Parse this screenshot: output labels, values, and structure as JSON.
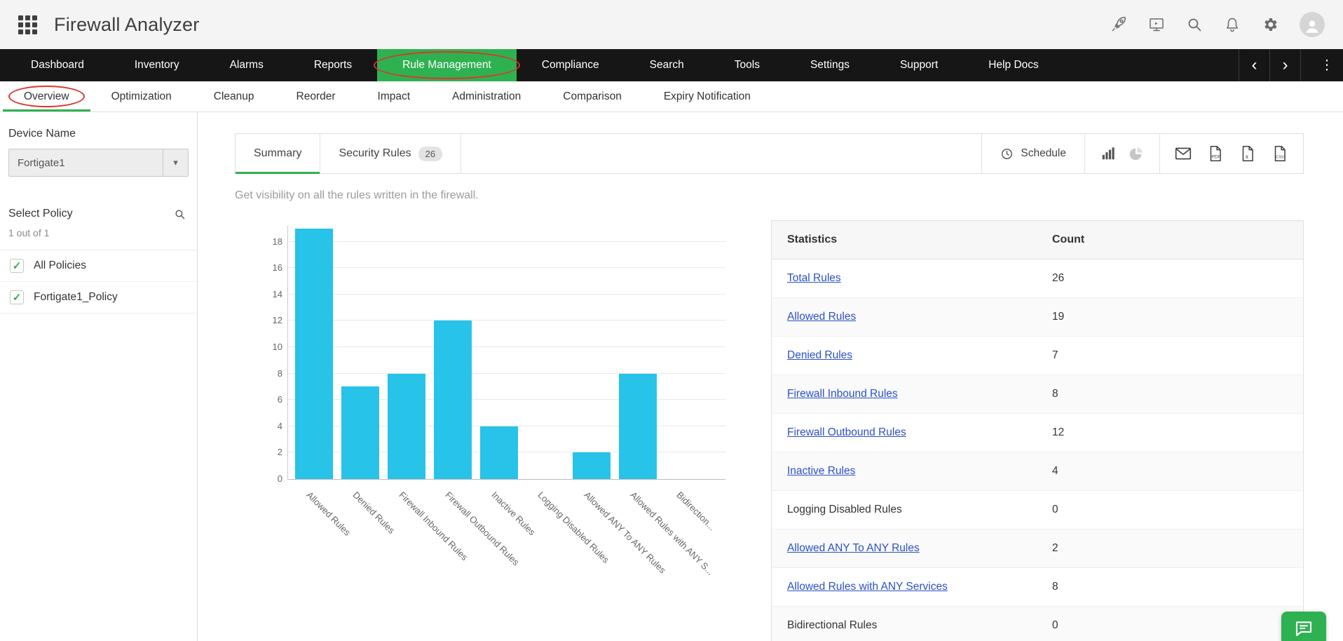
{
  "colors": {
    "accent_green": "#2eb150",
    "annotation_red": "#e0332c",
    "link_blue": "#2b50c8"
  },
  "icons": {
    "check": "✓",
    "caret": "▾",
    "chevron_left": "‹",
    "chevron_right": "›",
    "kebab": "⋮"
  },
  "header": {
    "title": "Firewall Analyzer"
  },
  "nav": {
    "items": [
      "Dashboard",
      "Inventory",
      "Alarms",
      "Reports",
      "Rule Management",
      "Compliance",
      "Search",
      "Tools",
      "Settings",
      "Support",
      "Help Docs"
    ],
    "active": "Rule Management",
    "annotated": "Rule Management"
  },
  "subnav": {
    "items": [
      "Overview",
      "Optimization",
      "Cleanup",
      "Reorder",
      "Impact",
      "Administration",
      "Comparison",
      "Expiry Notification"
    ],
    "active": "Overview",
    "annotated": "Overview"
  },
  "sidebar": {
    "device_label": "Device Name",
    "device_value": "Fortigate1",
    "policy_label": "Select Policy",
    "policy_count": "1 out of 1",
    "policies": [
      {
        "label": "All Policies",
        "checked": true
      },
      {
        "label": "Fortigate1_Policy",
        "checked": true
      }
    ]
  },
  "main": {
    "tabs": [
      {
        "label": "Summary"
      },
      {
        "label": "Security Rules",
        "badge": "26"
      }
    ],
    "active_tab": "Summary",
    "schedule_label": "Schedule",
    "subtitle": "Get visibility on all the rules written in the firewall."
  },
  "chart_data": {
    "type": "bar",
    "title": "",
    "categories": [
      "Allowed Rules",
      "Denied Rules",
      "Firewall Inbound Rules",
      "Firewall Outbound Rules",
      "Inactive Rules",
      "Logging Disabled Rules",
      "Allowed ANY To ANY Rules",
      "Allowed Rules with ANY S...",
      "Bidirection..."
    ],
    "values": [
      19,
      7,
      8,
      12,
      4,
      0,
      2,
      8,
      0
    ],
    "xlabel": "",
    "ylabel": "",
    "ylim": [
      0,
      19
    ],
    "yticks": [
      0,
      2,
      4,
      6,
      8,
      10,
      12,
      14,
      16,
      18
    ],
    "grid": true,
    "legend": false,
    "bar_color": "#27c3e8"
  },
  "stats_table": {
    "headers": [
      "Statistics",
      "Count"
    ],
    "rows": [
      {
        "label": "Total Rules",
        "count": "26",
        "link": true
      },
      {
        "label": "Allowed Rules",
        "count": "19",
        "link": true
      },
      {
        "label": "Denied Rules",
        "count": "7",
        "link": true
      },
      {
        "label": "Firewall Inbound Rules",
        "count": "8",
        "link": true
      },
      {
        "label": "Firewall Outbound Rules",
        "count": "12",
        "link": true
      },
      {
        "label": "Inactive Rules",
        "count": "4",
        "link": true
      },
      {
        "label": "Logging Disabled Rules",
        "count": "0",
        "link": false
      },
      {
        "label": "Allowed ANY To ANY Rules",
        "count": "2",
        "link": true
      },
      {
        "label": "Allowed Rules with ANY Services",
        "count": "8",
        "link": true
      },
      {
        "label": "Bidirectional Rules",
        "count": "0",
        "link": false
      }
    ]
  }
}
